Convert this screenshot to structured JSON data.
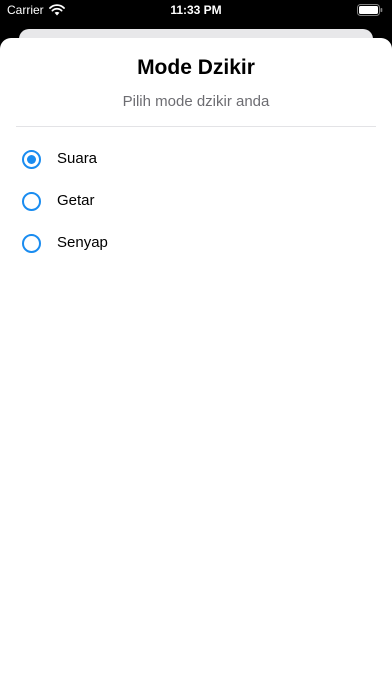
{
  "status_bar": {
    "carrier": "Carrier",
    "time": "11:33 PM",
    "icons": [
      "wifi-icon",
      "battery-icon"
    ]
  },
  "sheet": {
    "title": "Mode Dzikir",
    "subtitle": "Pilih mode dzikir anda",
    "options": [
      {
        "label": "Suara",
        "selected": true
      },
      {
        "label": "Getar",
        "selected": false
      },
      {
        "label": "Senyap",
        "selected": false
      }
    ]
  },
  "colors": {
    "accent": "#1a8cf0",
    "subtitle": "#6d6d72",
    "background": "#000000",
    "sheet": "#ffffff"
  }
}
